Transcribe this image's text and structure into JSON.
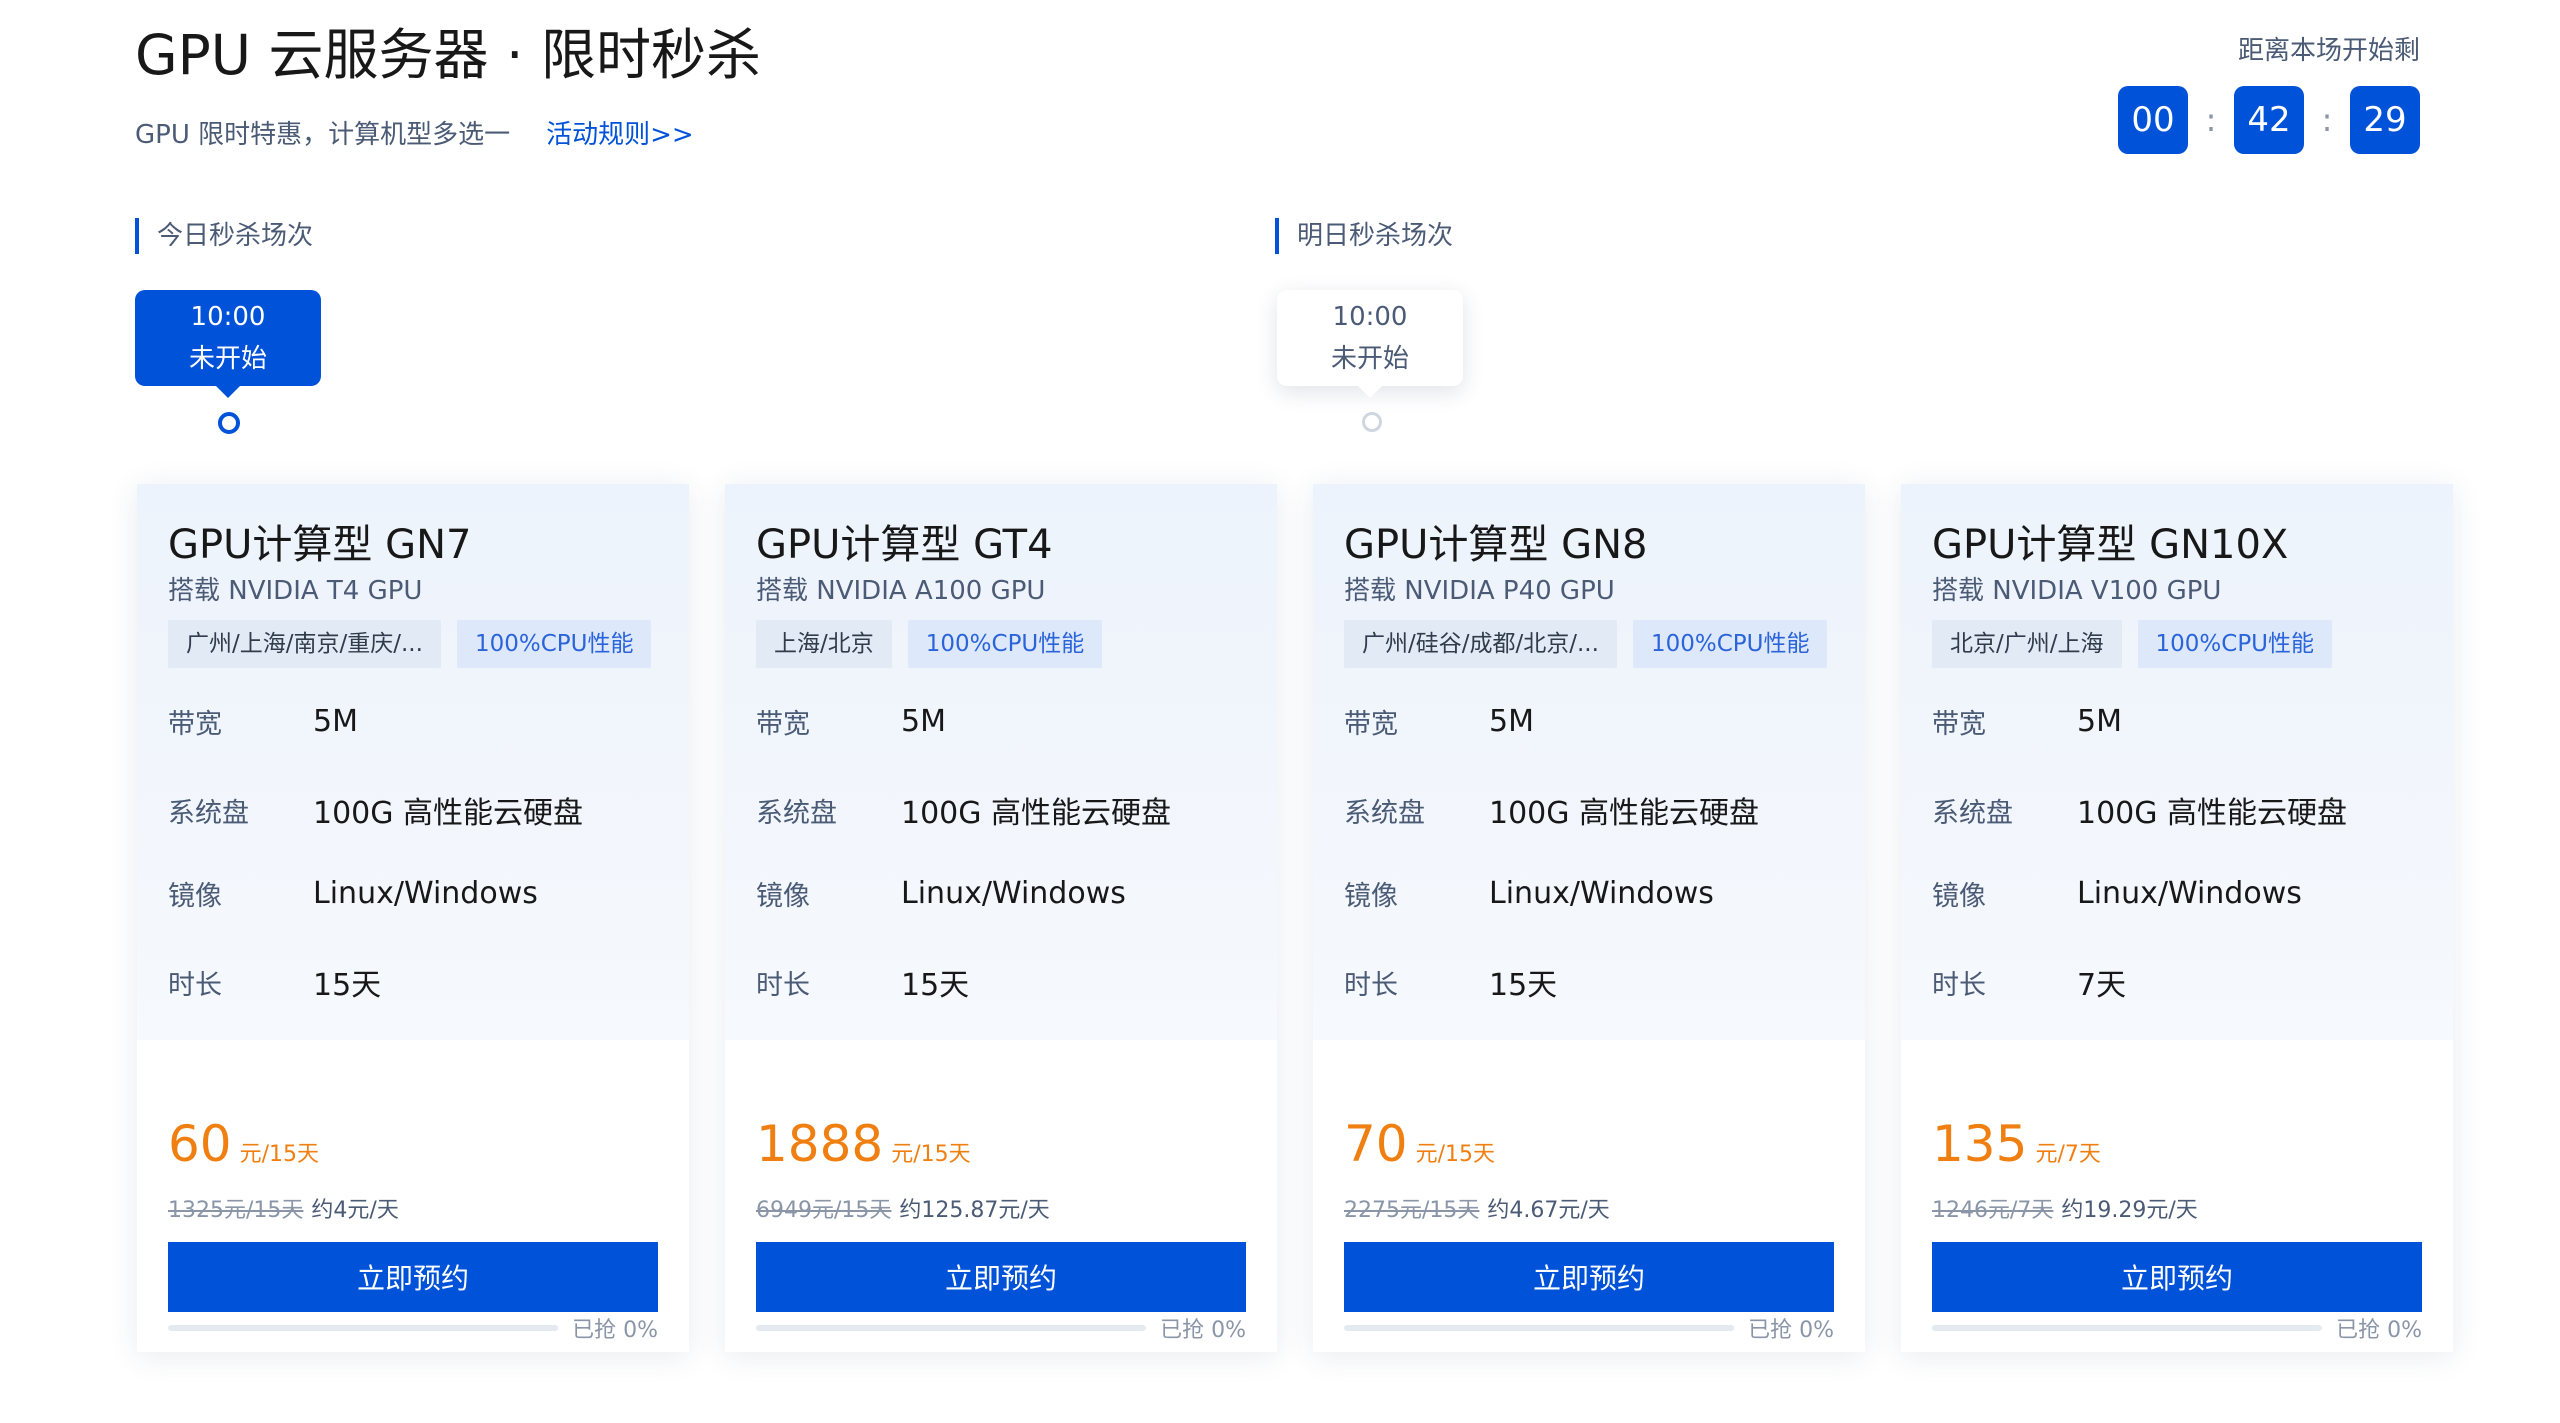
{
  "header": {
    "title": "GPU 云服务器 · 限时秒杀",
    "subtitle": "GPU 限时特惠，计算机型多选一",
    "rules_link": "活动规则>>"
  },
  "countdown": {
    "label": "距离本场开始剩",
    "hours": "00",
    "minutes": "42",
    "seconds": "29",
    "separator": ":"
  },
  "sessions": {
    "today": {
      "label": "今日秒杀场次",
      "time": "10:00",
      "status": "未开始"
    },
    "tomorrow": {
      "label": "明日秒杀场次",
      "time": "10:00",
      "status": "未开始"
    }
  },
  "spec_labels": {
    "bandwidth": "带宽",
    "disk": "系统盘",
    "image": "镜像",
    "duration": "时长"
  },
  "book_label": "立即预约",
  "products": [
    {
      "name": "GPU计算型 GN7",
      "gpu": "搭载 NVIDIA T4 GPU",
      "region_tag": "广州/上海/南京/重庆/...",
      "perf_tag": "100%CPU性能",
      "bandwidth": "5M",
      "disk": "100G 高性能云硬盘",
      "image": "Linux/Windows",
      "duration": "15天",
      "price": "60",
      "price_unit": "元/15天",
      "orig_price": "1325元/15天",
      "daily_price": "约4元/天",
      "sold_text": "已抢 0%",
      "sold_ratio": 0
    },
    {
      "name": "GPU计算型 GT4",
      "gpu": "搭载 NVIDIA A100 GPU",
      "region_tag": "上海/北京",
      "perf_tag": "100%CPU性能",
      "bandwidth": "5M",
      "disk": "100G 高性能云硬盘",
      "image": "Linux/Windows",
      "duration": "15天",
      "price": "1888",
      "price_unit": "元/15天",
      "orig_price": "6949元/15天",
      "daily_price": "约125.87元/天",
      "sold_text": "已抢 0%",
      "sold_ratio": 0
    },
    {
      "name": "GPU计算型 GN8",
      "gpu": "搭载 NVIDIA P40 GPU",
      "region_tag": "广州/硅谷/成都/北京/...",
      "perf_tag": "100%CPU性能",
      "bandwidth": "5M",
      "disk": "100G 高性能云硬盘",
      "image": "Linux/Windows",
      "duration": "15天",
      "price": "70",
      "price_unit": "元/15天",
      "orig_price": "2275元/15天",
      "daily_price": "约4.67元/天",
      "sold_text": "已抢 0%",
      "sold_ratio": 0
    },
    {
      "name": "GPU计算型 GN10X",
      "gpu": "搭载 NVIDIA V100 GPU",
      "region_tag": "北京/广州/上海",
      "perf_tag": "100%CPU性能",
      "bandwidth": "5M",
      "disk": "100G 高性能云硬盘",
      "image": "Linux/Windows",
      "duration": "7天",
      "price": "135",
      "price_unit": "元/7天",
      "orig_price": "1246元/7天",
      "daily_price": "约19.29元/天",
      "sold_text": "已抢 0%",
      "sold_ratio": 0
    }
  ],
  "colors": {
    "accent": "#0052d9",
    "price": "#f07f12",
    "muted": "#4b5b76"
  }
}
